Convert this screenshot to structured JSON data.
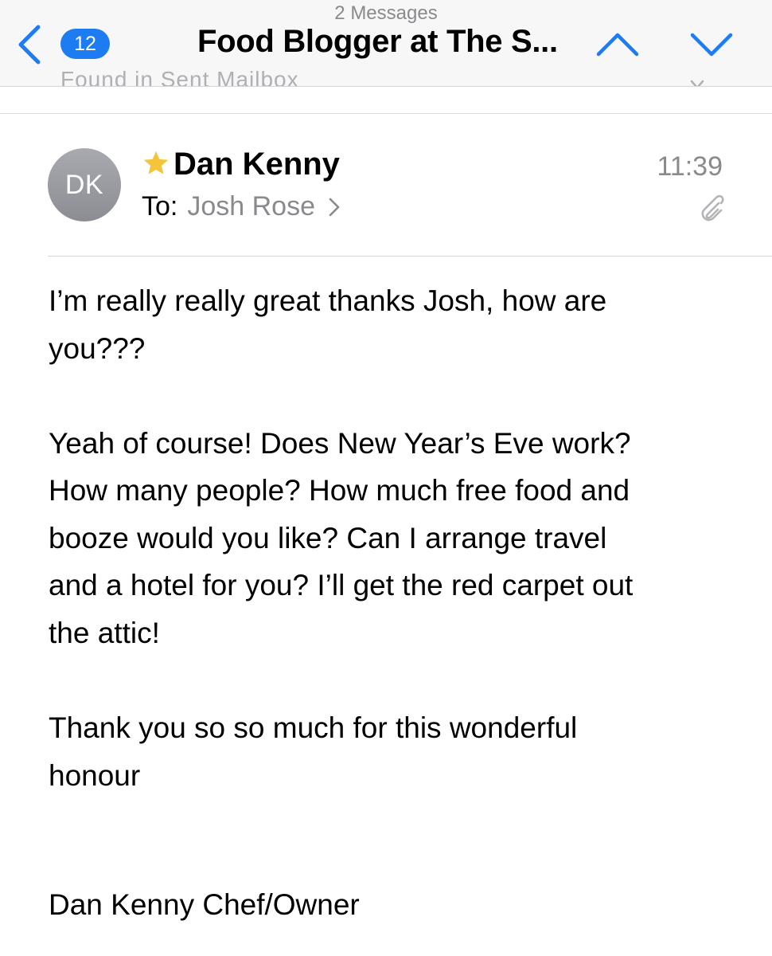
{
  "navbar": {
    "subtitle": "2 Messages",
    "back_badge": "12",
    "title": "Food Blogger at The S..."
  },
  "previous_message": {
    "peek_text": "Found in Sent Mailbox"
  },
  "message": {
    "avatar_initials": "DK",
    "sender": "Dan Kenny",
    "time": "11:39",
    "to_label": "To:",
    "recipient": "Josh Rose",
    "flag_color": "#f4c43a",
    "body_lines": [
      "I’m really really great thanks Josh, how are",
      "you???",
      "Yeah of course! Does New Year’s Eve work?",
      "How many people? How much free food and",
      "booze would you like? Can I arrange travel",
      "and a hotel for you? I’ll get the red carpet out",
      "the attic!",
      "Thank you so so much for this wonderful",
      "honour",
      "Dan Kenny Chef/Owner"
    ]
  },
  "icons": {
    "back": "chevron-left-icon",
    "up": "chevron-up-icon",
    "down": "chevron-down-icon",
    "star": "star-icon",
    "attachment": "paperclip-icon",
    "accent_color": "#1e7cf2"
  }
}
